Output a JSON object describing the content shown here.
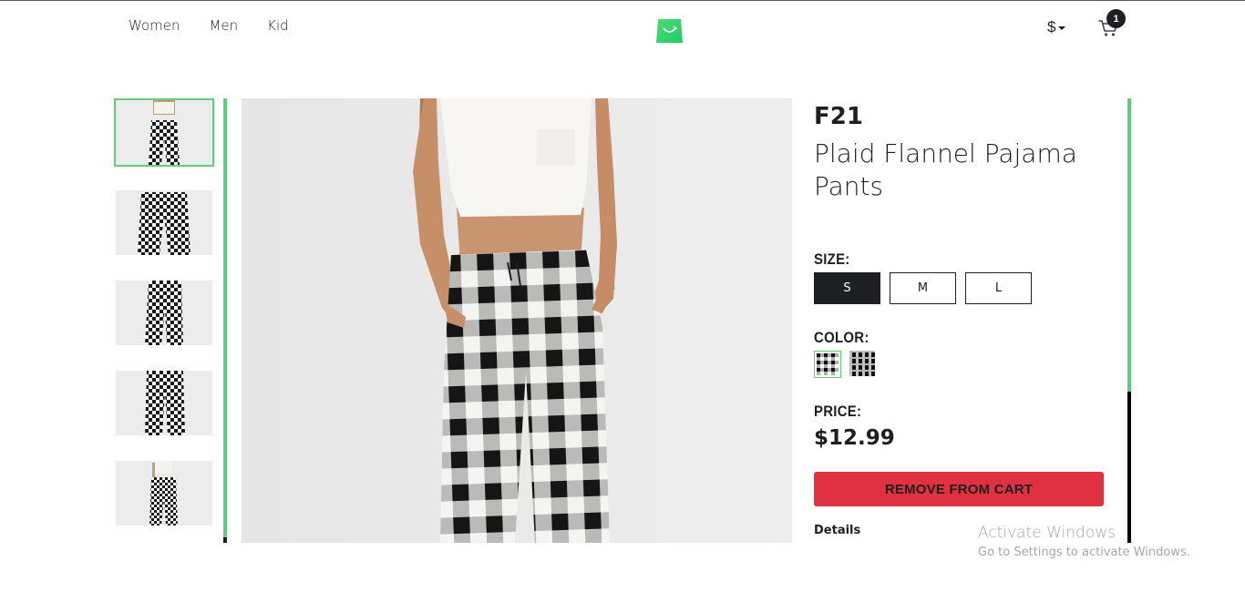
{
  "header": {
    "nav": [
      "Women",
      "Men",
      "Kid"
    ],
    "currency_symbol": "$",
    "cart_count": "1",
    "brand_color": "#5ece7b"
  },
  "gallery": {
    "thumbnail_count": 5,
    "active_index": 0,
    "thumb_icons": [
      "pants-thumbnail-1",
      "pants-thumbnail-2",
      "pants-thumbnail-3",
      "pants-thumbnail-4",
      "pants-thumbnail-5"
    ]
  },
  "product": {
    "brand": "F21",
    "name": "Plaid Flannel Pajama Pants",
    "size_label": "SIZE:",
    "sizes": [
      "S",
      "M",
      "L"
    ],
    "selected_size": "S",
    "color_label": "COLOR:",
    "colors": [
      "plaid-swatch-1",
      "plaid-swatch-2"
    ],
    "selected_color_index": 0,
    "price_label": "PRICE:",
    "price": "$12.99",
    "cart_button": "REMOVE FROM CART",
    "cart_button_color": "#e03140",
    "details_label": "Details"
  },
  "watermark": {
    "title": "Activate Windows",
    "subtitle": "Go to Settings to activate Windows."
  }
}
